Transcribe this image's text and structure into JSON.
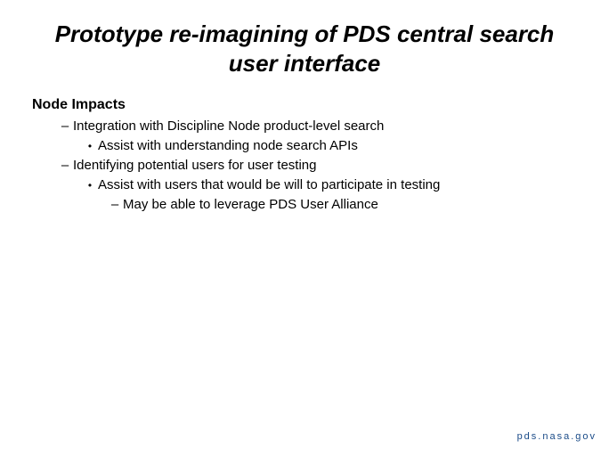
{
  "title": "Prototype re-imagining of PDS central search user interface",
  "section_heading": "Node Impacts",
  "items": [
    {
      "level": 1,
      "marker": "–",
      "text": "Integration with Discipline Node product-level search"
    },
    {
      "level": 2,
      "marker": "•",
      "text": "Assist with understanding node search APIs"
    },
    {
      "level": 1,
      "marker": "–",
      "text": "Identifying potential users for user testing"
    },
    {
      "level": 2,
      "marker": "•",
      "text": "Assist with users that would be will to participate in testing"
    },
    {
      "level": 3,
      "marker": "–",
      "text": "May be able to leverage PDS User Alliance"
    }
  ],
  "footer": "pds.nasa.gov"
}
